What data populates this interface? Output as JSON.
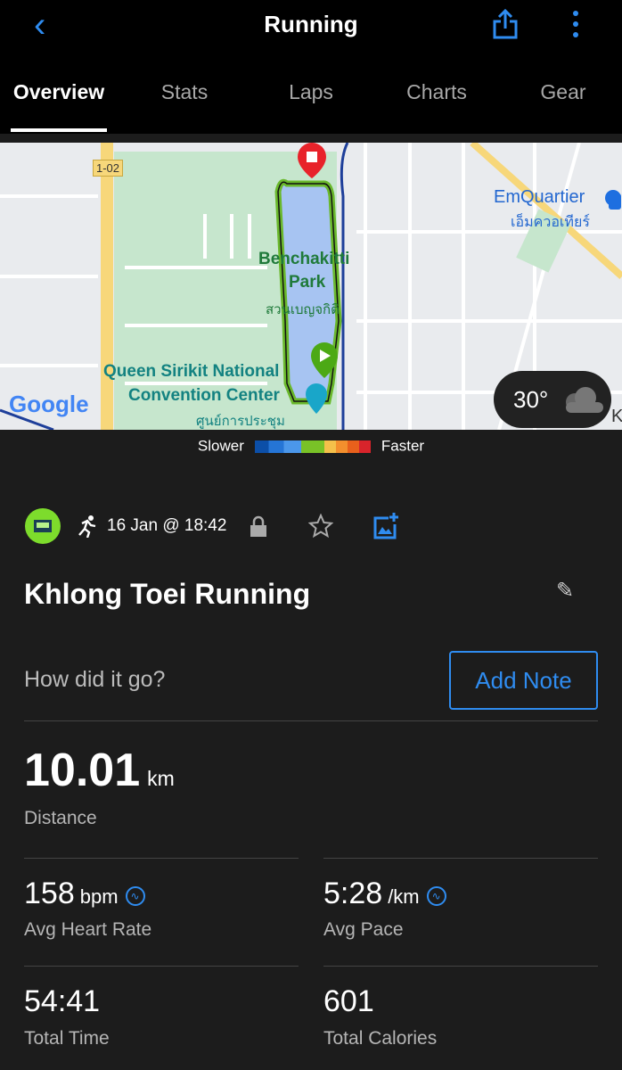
{
  "header": {
    "title": "Running",
    "back_icon": "chevron-left-icon",
    "share_icon": "share-icon",
    "more_icon": "more-vertical-icon"
  },
  "tabs": [
    {
      "label": "Overview",
      "active": true
    },
    {
      "label": "Stats"
    },
    {
      "label": "Laps"
    },
    {
      "label": "Charts"
    },
    {
      "label": "Gear"
    }
  ],
  "map": {
    "labels": {
      "road": "1-02",
      "park": "Benchakitti",
      "park2": "Park",
      "park_thai": "สวนเบญจกิติ",
      "center1": "Queen Sirikit National",
      "center2": "Convention Center",
      "center_thai": "ศูนย์การประชุม",
      "mall": "EmQuartier",
      "mall_thai": "เอ็มควอเทียร์",
      "edge": "K"
    },
    "logo": "Google",
    "weather": "30°",
    "weather_icon": "cloud-icon"
  },
  "legend": {
    "slower": "Slower",
    "faster": "Faster"
  },
  "activity": {
    "date": "16 Jan @ 18:42",
    "name": "Khlong Toei Running",
    "prompt": "How did it go?",
    "add_note": "Add Note"
  },
  "stats": {
    "distance": {
      "value": "10.01",
      "unit": "km",
      "label": "Distance"
    },
    "heart": {
      "value": "158",
      "unit": "bpm",
      "label": "Avg Heart Rate"
    },
    "pace": {
      "value": "5:28",
      "unit": "/km",
      "label": "Avg Pace"
    },
    "time": {
      "value": "54:41",
      "label": "Total Time"
    },
    "calories": {
      "value": "601",
      "label": "Total Calories"
    }
  },
  "colors": {
    "accent": "#2f8cf0",
    "background": "#1c1c1c"
  }
}
